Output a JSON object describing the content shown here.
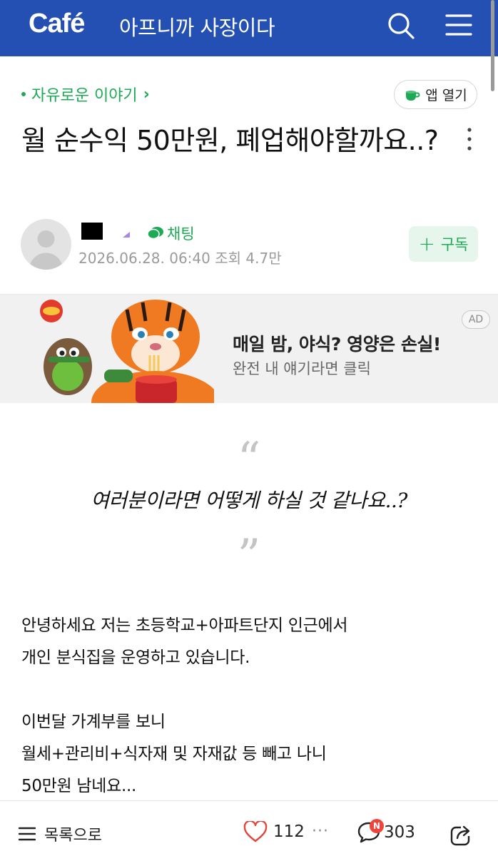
{
  "header": {
    "logo": "Café",
    "cafe_name": "아프니까 사장이다",
    "brand_color": "#2450b3"
  },
  "post": {
    "category": "자유로운 이야기",
    "app_open_label": "앱 열기",
    "title": "월 순수익 50만원, 폐업해야할까요..?",
    "chat_label": "채팅",
    "date": "2026.06.28. 06:40",
    "views": "조회 4.7만",
    "subscribe_label": "구독",
    "accent_color": "#1ea954"
  },
  "ad": {
    "title": "매일 밤, 야식? 영양은 손실!",
    "subtitle": "완전 내 얘기라면 클릭",
    "label": "AD"
  },
  "quote": {
    "open_mark": "“",
    "text": "여러분이라면 어떻게 하실 것 같나요..?",
    "close_mark": "”"
  },
  "body": {
    "lines": [
      "안녕하세요 저는 초등학교+아파트단지 인근에서",
      "개인 분식집을 운영하고 있습니다.",
      "",
      "이번달 가계부를 보니",
      "월세+관리비+식자재 및 자재값 등 빼고 나니",
      "50만원 남네요..."
    ]
  },
  "bottombar": {
    "list_label": "목록으로",
    "like_count": "112",
    "more": "···",
    "comment_badge": "N",
    "comment_count": "303"
  },
  "icons": {
    "search": "search-icon",
    "menu": "menu-icon",
    "more": "more-vertical-icon",
    "heart": "heart-icon",
    "comment": "comment-icon",
    "share": "share-icon"
  }
}
